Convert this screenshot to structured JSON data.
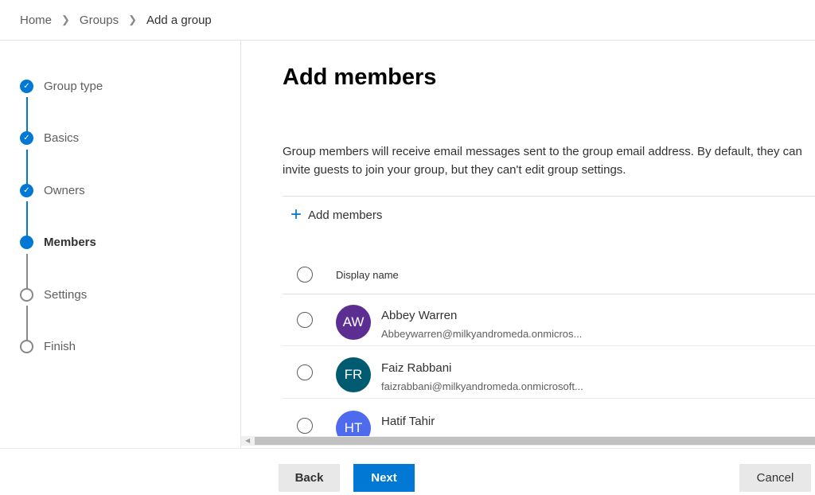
{
  "breadcrumb": [
    "Home",
    "Groups",
    "Add a group"
  ],
  "steps": [
    {
      "label": "Group type",
      "state": "done"
    },
    {
      "label": "Basics",
      "state": "done"
    },
    {
      "label": "Owners",
      "state": "done"
    },
    {
      "label": "Members",
      "state": "current"
    },
    {
      "label": "Settings",
      "state": "todo"
    },
    {
      "label": "Finish",
      "state": "todo"
    }
  ],
  "main": {
    "title": "Add members",
    "description": "Group members will receive email messages sent to the group email address. By default, they can invite guests to join your group, but they can't edit group settings.",
    "add_label": "Add members",
    "column_header": "Display name",
    "members": [
      {
        "initials": "AW",
        "name": "Abbey Warren",
        "email": "Abbeywarren@milkyandromeda.onmicros...",
        "color": "#5c2e91"
      },
      {
        "initials": "FR",
        "name": "Faiz Rabbani",
        "email": "faizrabbani@milkyandromeda.onmicrosoft...",
        "color": "#005b70"
      },
      {
        "initials": "HT",
        "name": "Hatif Tahir",
        "color": "#4f6bed"
      }
    ]
  },
  "footer": {
    "back": "Back",
    "next": "Next",
    "cancel": "Cancel"
  },
  "colors": {
    "accent": "#0078d4"
  }
}
